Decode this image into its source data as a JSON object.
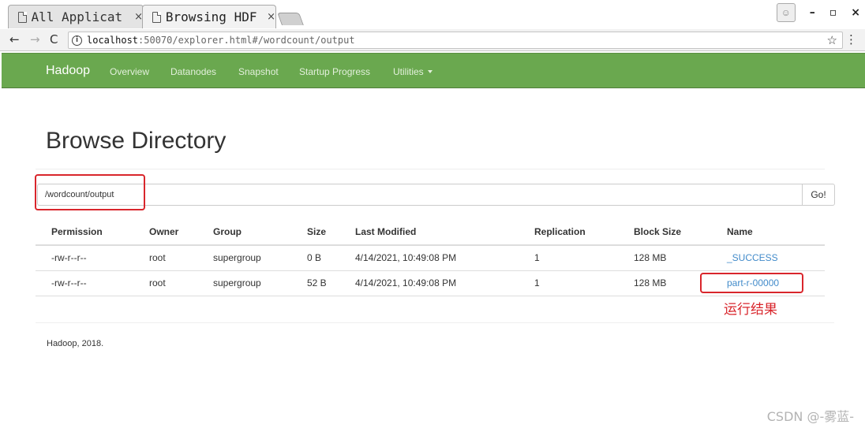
{
  "browser": {
    "tabs": [
      {
        "title": "All Applicat",
        "close": "×",
        "active": false
      },
      {
        "title": "Browsing HDF",
        "close": "×",
        "active": true
      }
    ],
    "window_buttons": {
      "minimize": "–",
      "maximize": "▫",
      "close": "×"
    },
    "address": {
      "host": "localhost",
      "rest": ":50070/explorer.html#/wordcount/output"
    }
  },
  "navbar": {
    "brand": "Hadoop",
    "links": [
      "Overview",
      "Datanodes",
      "Snapshot",
      "Startup Progress",
      "Utilities"
    ],
    "color": "#6aa84f"
  },
  "page": {
    "title": "Browse Directory",
    "path_value": "/wordcount/output",
    "go_label": "Go!"
  },
  "table": {
    "headers": [
      "Permission",
      "Owner",
      "Group",
      "Size",
      "Last Modified",
      "Replication",
      "Block Size",
      "Name"
    ],
    "rows": [
      {
        "permission": "-rw-r--r--",
        "owner": "root",
        "group": "supergroup",
        "size": "0 B",
        "modified": "4/14/2021, 10:49:08 PM",
        "replication": "1",
        "block_size": "128 MB",
        "name": "_SUCCESS"
      },
      {
        "permission": "-rw-r--r--",
        "owner": "root",
        "group": "supergroup",
        "size": "52 B",
        "modified": "4/14/2021, 10:49:08 PM",
        "replication": "1",
        "block_size": "128 MB",
        "name": "part-r-00000"
      }
    ]
  },
  "annotation": {
    "text": "运行结果",
    "color": "#d9262c"
  },
  "footer": "Hadoop, 2018.",
  "watermark": "CSDN @-雾蓝-"
}
